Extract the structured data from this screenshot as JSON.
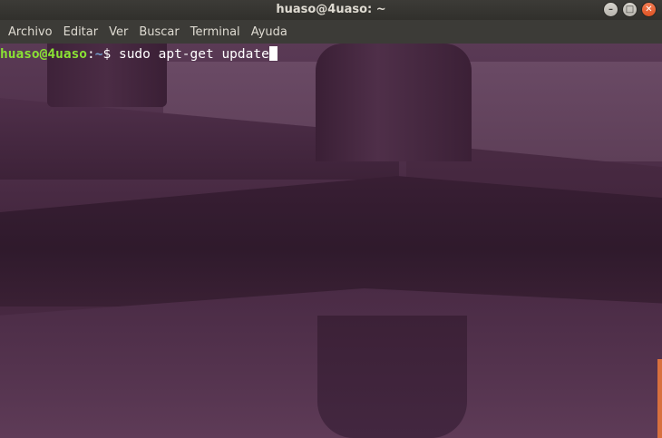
{
  "window": {
    "title": "huaso@4uaso: ~",
    "buttons": {
      "minimize_icon": "minimize-icon",
      "maximize_icon": "maximize-icon",
      "close_icon": "close-icon"
    }
  },
  "menu": {
    "items": [
      {
        "label": "Archivo"
      },
      {
        "label": "Editar"
      },
      {
        "label": "Ver"
      },
      {
        "label": "Buscar"
      },
      {
        "label": "Terminal"
      },
      {
        "label": "Ayuda"
      }
    ]
  },
  "terminal": {
    "prompt_user": "huaso@4uaso",
    "prompt_sep": ":",
    "prompt_path": "~",
    "prompt_symbol": "$ ",
    "command": "sudo apt-get update"
  },
  "colors": {
    "prompt_user": "#8ae234",
    "prompt_path": "#729fcf",
    "titlebar": "#3c3b37",
    "accent": "#d8703e"
  }
}
